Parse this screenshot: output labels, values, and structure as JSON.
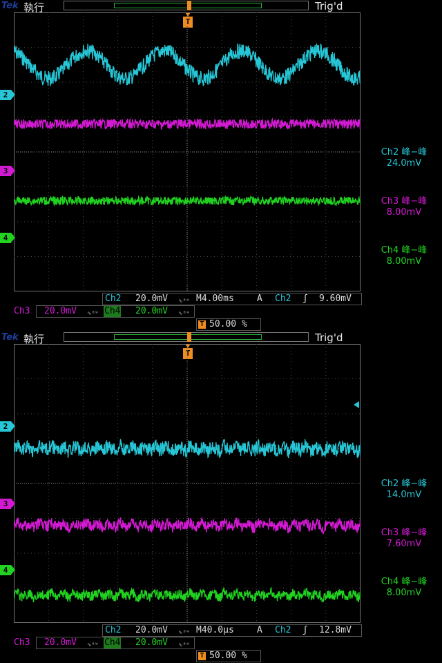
{
  "colors": {
    "ch2": "#27c6d6",
    "ch3": "#d21ad2",
    "ch4": "#21d221",
    "trigger": "#f08c20",
    "grid": "#4a4a4a"
  },
  "screens": [
    {
      "brand": "Tek",
      "run_state": "執行",
      "trigger_status": "Trig'd",
      "trigger_marker": "T",
      "trigger_level_marker": "◂",
      "channels": [
        {
          "label": "2",
          "waveform": "sine",
          "cycles": 4.5,
          "amplitude_div": 0.4,
          "noise_div": 0.22,
          "level_div": -2.5
        },
        {
          "label": "3",
          "waveform": "flat",
          "amplitude_div": 0.0,
          "noise_div": 0.14,
          "level_div": -0.8
        },
        {
          "label": "4",
          "waveform": "flat",
          "amplitude_div": 0.0,
          "noise_div": 0.12,
          "level_div": 1.4
        }
      ],
      "measurements": [
        {
          "title": "Ch2 峰−峰",
          "value": "24.0mV"
        },
        {
          "title": "Ch3 峰−峰",
          "value": "8.00mV"
        },
        {
          "title": "Ch4 峰−峰",
          "value": "8.00mV"
        }
      ],
      "status": {
        "ch2_label": "Ch2",
        "ch2_scale": "20.0mV",
        "ch3_label": "Ch3",
        "ch3_scale": "20.0mV",
        "ch4_label": "Ch4",
        "ch4_scale": "20.0mV",
        "bw_symbol": "∿ᴮᵂ",
        "timebase": "M4.00ms",
        "trigger_mode": "A",
        "trigger_source": "Ch2",
        "trigger_slope": "ʃ",
        "trigger_level": "9.60mV",
        "trigger_position": "50.00 %"
      }
    },
    {
      "brand": "Tek",
      "run_state": "執行",
      "trigger_status": "Trig'd",
      "trigger_marker": "T",
      "trigger_level_marker": "◂",
      "channels": [
        {
          "label": "2",
          "waveform": "noise",
          "cycles": 30,
          "amplitude_div": 0.08,
          "noise_div": 0.2,
          "level_div": -1.0
        },
        {
          "label": "3",
          "waveform": "noise",
          "cycles": 30,
          "amplitude_div": 0.08,
          "noise_div": 0.16,
          "level_div": 1.2
        },
        {
          "label": "4",
          "waveform": "noise",
          "cycles": 30,
          "amplitude_div": 0.08,
          "noise_div": 0.14,
          "level_div": 3.2
        }
      ],
      "measurements": [
        {
          "title": "Ch2 峰−峰",
          "value": "14.0mV"
        },
        {
          "title": "Ch3 峰−峰",
          "value": "7.60mV"
        },
        {
          "title": "Ch4 峰−峰",
          "value": "8.00mV"
        }
      ],
      "status": {
        "ch2_label": "Ch2",
        "ch2_scale": "20.0mV",
        "ch3_label": "Ch3",
        "ch3_scale": "20.0mV",
        "ch4_label": "Ch4",
        "ch4_scale": "20.0mV",
        "bw_symbol": "∿ᴮᵂ",
        "timebase": "M40.0µs",
        "trigger_mode": "A",
        "trigger_source": "Ch2",
        "trigger_slope": "ʃ",
        "trigger_level": "12.8mV",
        "trigger_position": "50.00 %"
      }
    }
  ]
}
